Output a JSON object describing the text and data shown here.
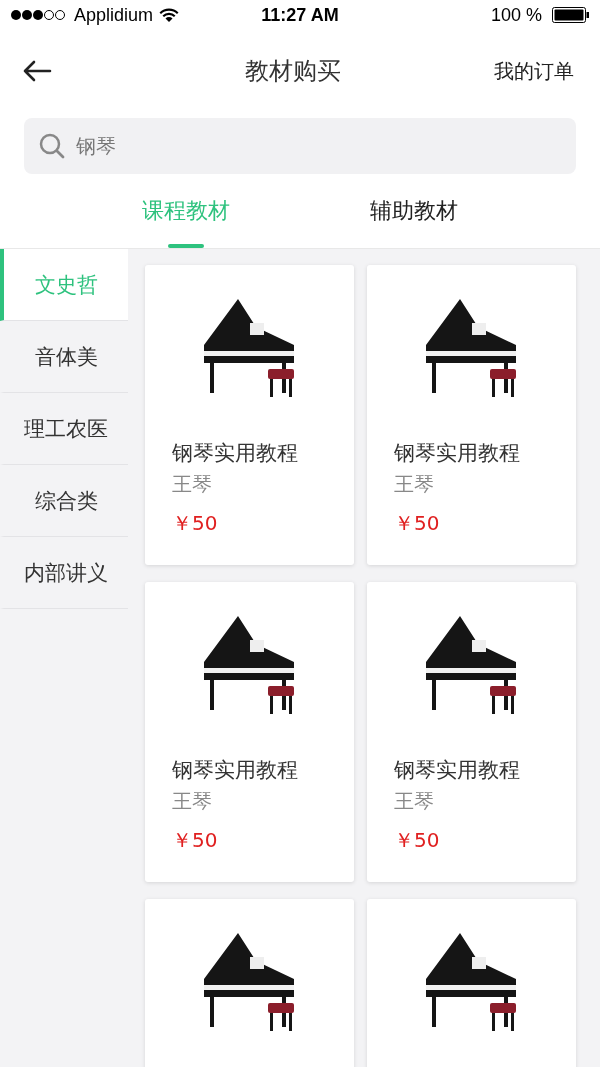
{
  "status_bar": {
    "carrier": "Applidium",
    "time": "11:27 AM",
    "battery": "100 %"
  },
  "nav": {
    "title": "教材购买",
    "action": "我的订单"
  },
  "search": {
    "value": "钢琴"
  },
  "tabs": [
    {
      "label": "课程教材",
      "selected": true
    },
    {
      "label": "辅助教材",
      "selected": false
    }
  ],
  "sidebar": {
    "items": [
      {
        "label": "文史哲",
        "selected": true
      },
      {
        "label": "音体美",
        "selected": false
      },
      {
        "label": "理工农医",
        "selected": false
      },
      {
        "label": "综合类",
        "selected": false
      },
      {
        "label": "内部讲义",
        "selected": false
      }
    ]
  },
  "products": [
    {
      "kind": "full",
      "title": "钢琴实用教程",
      "author": "王琴",
      "price": "￥50"
    },
    {
      "kind": "full",
      "title": "钢琴实用教程",
      "author": "王琴",
      "price": "￥50"
    },
    {
      "kind": "full",
      "title": "钢琴实用教程",
      "author": "王琴",
      "price": "￥50"
    },
    {
      "kind": "full",
      "title": "钢琴实用教程",
      "author": "王琴",
      "price": "￥50"
    },
    {
      "kind": "image"
    },
    {
      "kind": "image"
    }
  ]
}
